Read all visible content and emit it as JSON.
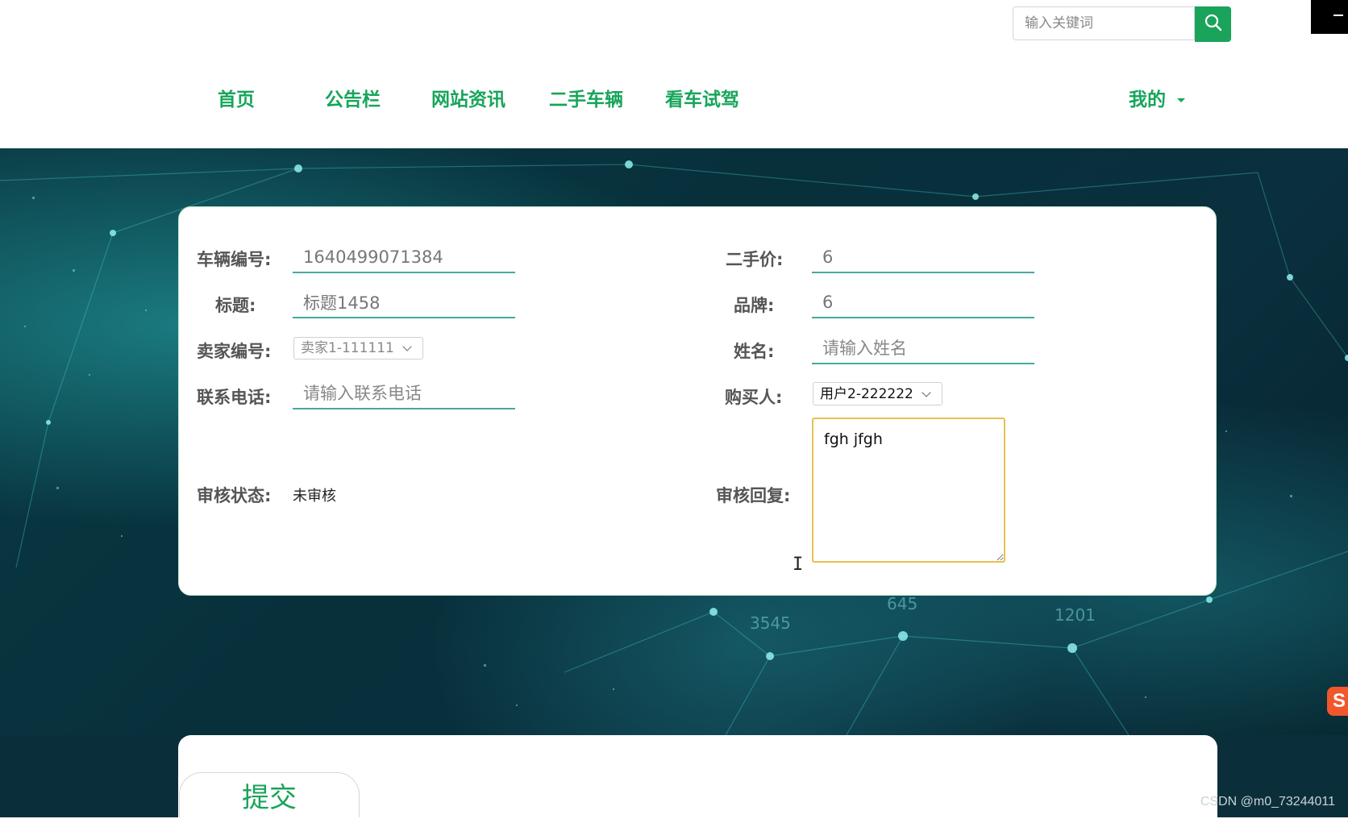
{
  "header": {
    "search_placeholder": "输入关键词",
    "search_icon": "search-icon"
  },
  "nav": {
    "items": [
      "首页",
      "公告栏",
      "网站资讯",
      "二手车辆",
      "看车试驾"
    ],
    "mine": "我的"
  },
  "form": {
    "vehicle_no_label": "车辆编号:",
    "vehicle_no_value": "1640499071384",
    "price_label": "二手价:",
    "price_value": "6",
    "title_label": "标题:",
    "title_value": "标题1458",
    "brand_label": "品牌:",
    "brand_value": "6",
    "seller_label": "卖家编号:",
    "seller_value": "卖家1-111111",
    "name_label": "姓名:",
    "name_placeholder": "请输入姓名",
    "phone_label": "联系电话:",
    "phone_placeholder": "请输入联系电话",
    "buyer_label": "购买人:",
    "buyer_value": "用户2-222222",
    "status_label": "审核状态:",
    "status_value": "未审核",
    "reply_label": "审核回复:",
    "reply_value": "fgh jfgh"
  },
  "submit": {
    "label": "提交"
  },
  "watermark": "CSDN @m0_73244011",
  "banner_numbers": [
    "645",
    "3545",
    "1201"
  ],
  "colors": {
    "accent": "#1aa35a",
    "underline": "#48a9a0",
    "focus_border": "#e8c04f"
  }
}
